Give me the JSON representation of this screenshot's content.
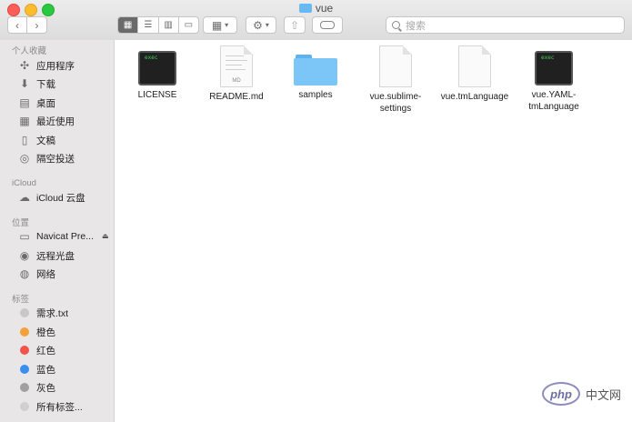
{
  "window": {
    "title": "vue"
  },
  "toolbar": {
    "back": "‹",
    "forward": "›",
    "search_placeholder": "搜索"
  },
  "sidebar": {
    "favorites_header": "个人收藏",
    "favorites": [
      {
        "label": "应用程序",
        "icon": "applications-icon"
      },
      {
        "label": "下载",
        "icon": "downloads-icon"
      },
      {
        "label": "桌面",
        "icon": "desktop-icon"
      },
      {
        "label": "最近使用",
        "icon": "recents-icon"
      },
      {
        "label": "文稿",
        "icon": "documents-icon"
      },
      {
        "label": "隔空投送",
        "icon": "airdrop-icon"
      }
    ],
    "icloud_header": "iCloud",
    "icloud": [
      {
        "label": "iCloud 云盘",
        "icon": "cloud-icon"
      }
    ],
    "locations_header": "位置",
    "locations": [
      {
        "label": "Navicat Pre...",
        "icon": "disk-icon"
      },
      {
        "label": "远程光盘",
        "icon": "remote-disc-icon"
      },
      {
        "label": "网络",
        "icon": "network-icon"
      }
    ],
    "tags_header": "标签",
    "tags": [
      {
        "label": "需求.txt",
        "color": "#c8c8c8"
      },
      {
        "label": "橙色",
        "color": "#f5a13b"
      },
      {
        "label": "红色",
        "color": "#f0544c"
      },
      {
        "label": "蓝色",
        "color": "#3a8ef0"
      },
      {
        "label": "灰色",
        "color": "#a0a0a0"
      },
      {
        "label": "所有标签...",
        "color": "#d0d0d0"
      }
    ]
  },
  "files": [
    {
      "name": "LICENSE",
      "kind": "exec",
      "icon_text": "exec"
    },
    {
      "name": "README.md",
      "kind": "md",
      "icon_text": "MD"
    },
    {
      "name": "samples",
      "kind": "folder"
    },
    {
      "name": "vue.sublime-settings",
      "kind": "doc"
    },
    {
      "name": "vue.tmLanguage",
      "kind": "doc"
    },
    {
      "name": "vue.YAML-tmLanguage",
      "kind": "exec",
      "icon_text": "exec"
    }
  ],
  "watermark": {
    "logo": "php",
    "text": "中文网"
  }
}
